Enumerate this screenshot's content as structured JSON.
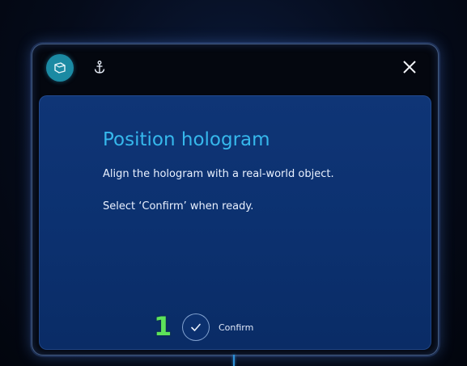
{
  "window": {
    "app_icon": "hologram-app-icon",
    "anchor_icon": "anchor-icon",
    "close_icon": "close-icon"
  },
  "panel": {
    "title": "Position hologram",
    "instructions": [
      "Align the hologram with a real-world object.",
      "Select ‘Confirm’ when ready."
    ],
    "step_number": "1",
    "confirm_label": "Confirm",
    "confirm_icon": "checkmark-icon"
  },
  "colors": {
    "title": "#36b8ec",
    "panel_background": "#0f3576",
    "app_icon_background": "#1b8aa3",
    "step_number": "#5de35a"
  }
}
